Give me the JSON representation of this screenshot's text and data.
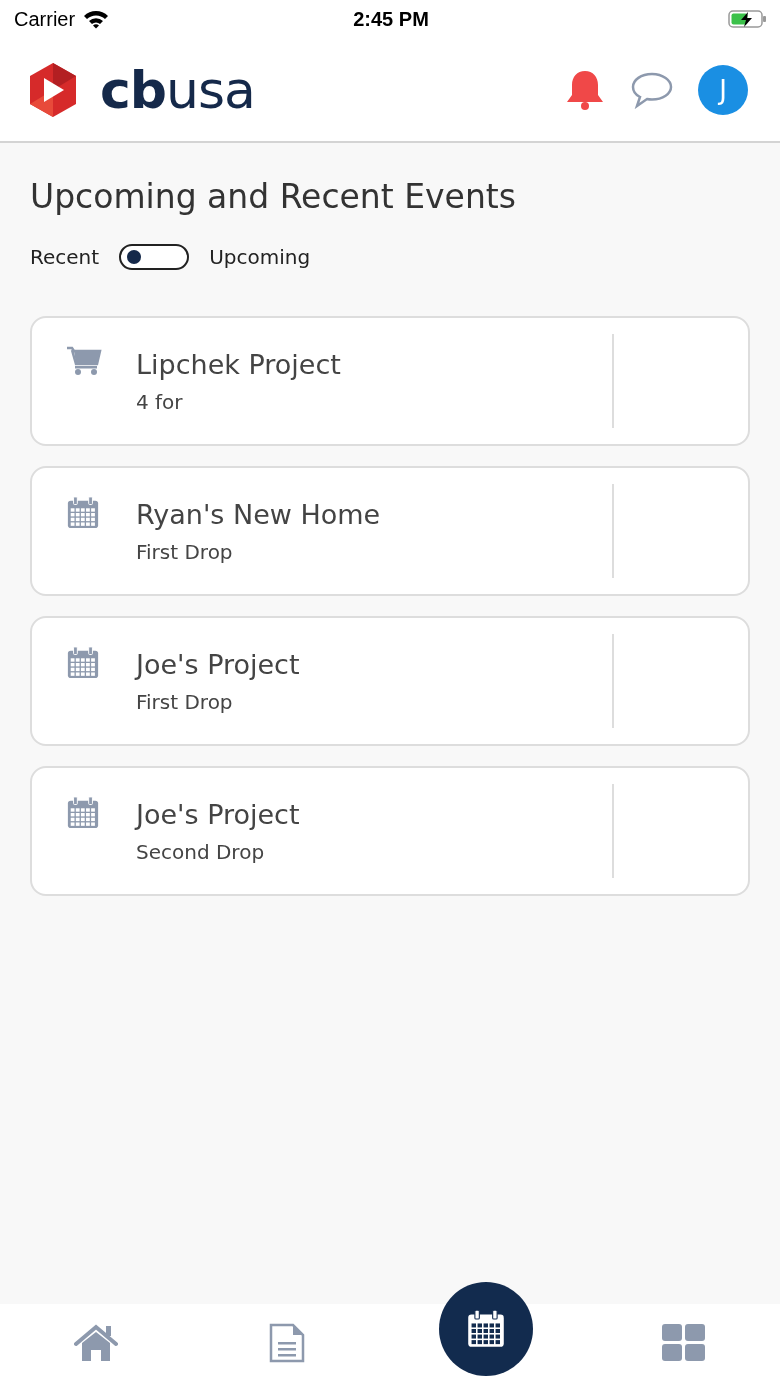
{
  "status_bar": {
    "carrier": "Carrier",
    "time": "2:45 PM",
    "battery_charging": true
  },
  "header": {
    "logo": "**cb**usa",
    "avatar": "J",
    "notifications_alert": true
  },
  "title": "Upcoming and Recent Events",
  "toggle": {
    "left_label": "Recent",
    "right_label": "Upcoming",
    "on": false
  },
  "events": [
    {
      "kind": "cart",
      "title": "Lipchek Project",
      "subtitle": "4 for"
    },
    {
      "kind": "calendar",
      "title": "Ryan's New Home",
      "subtitle": "First Drop"
    },
    {
      "kind": "calendar",
      "title": "Joe's Project",
      "subtitle": "First Drop"
    },
    {
      "kind": "calendar",
      "title": "Joe's Project",
      "subtitle": "Second Drop"
    }
  ],
  "tab_bar": [
    {
      "kind": "home",
      "selected": false
    },
    {
      "kind": "document",
      "selected": false
    },
    {
      "kind": "calendar",
      "selected": true
    },
    {
      "kind": "grid",
      "selected": false
    }
  ]
}
